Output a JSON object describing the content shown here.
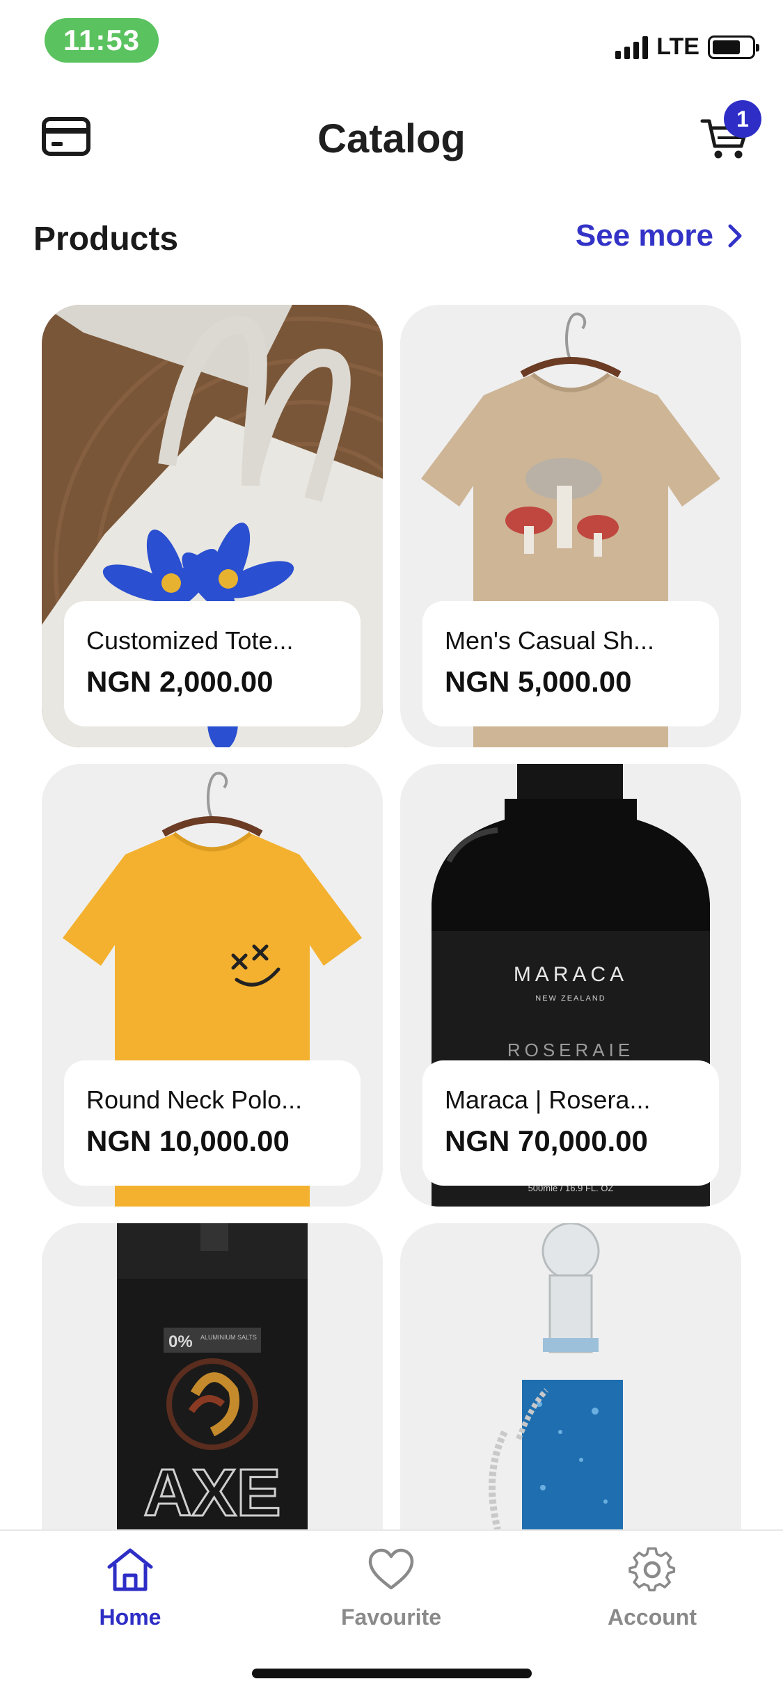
{
  "status_bar": {
    "time": "11:53",
    "network": "LTE"
  },
  "header": {
    "title": "Catalog",
    "cart_count": "1"
  },
  "section": {
    "title": "Products",
    "see_more": "See more"
  },
  "products": [
    {
      "name": "Customized Tote...",
      "price": "NGN 2,000.00"
    },
    {
      "name": "Men's Casual Sh...",
      "price": "NGN 5,000.00"
    },
    {
      "name": "Round Neck Polo...",
      "price": "NGN 10,000.00"
    },
    {
      "name": "Maraca | Rosera...",
      "price": "NGN 70,000.00"
    },
    {
      "name": "",
      "price": ""
    },
    {
      "name": "",
      "price": ""
    }
  ],
  "product_art": {
    "perfume_brand": "MARACA",
    "perfume_origin": "NEW ZEALAND",
    "perfume_line": "ROSERAIE",
    "perfume_volume": "500mle / 16.9 FL. OZ",
    "deodorant_badge": "0%",
    "deodorant_badge_sub": "ALUMINIUM SALTS",
    "deodorant_brand": "AXE"
  },
  "tabs": [
    {
      "label": "Home",
      "icon": "home-icon",
      "active": true
    },
    {
      "label": "Favourite",
      "icon": "heart-icon",
      "active": false
    },
    {
      "label": "Account",
      "icon": "gear-icon",
      "active": false
    }
  ],
  "colors": {
    "accent": "#2e2ec6",
    "status_pill": "#5ac25f",
    "card_bg": "#efefef",
    "inactive": "#8a8a8a"
  }
}
